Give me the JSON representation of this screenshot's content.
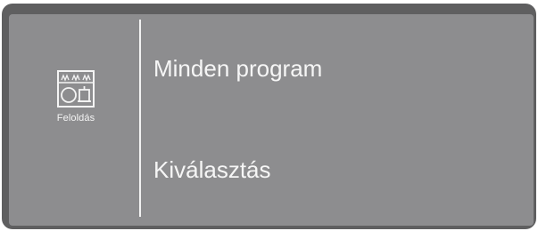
{
  "side_panel": {
    "icon": "dishwasher-rack-icon",
    "label": "Feloldás"
  },
  "menu": {
    "items": [
      {
        "label": "Minden program"
      },
      {
        "label": "Kiválasztás"
      }
    ]
  },
  "colors": {
    "bezel": "#5f5f60",
    "screen": "#8d8d8f",
    "text": "#f6f6f6"
  }
}
